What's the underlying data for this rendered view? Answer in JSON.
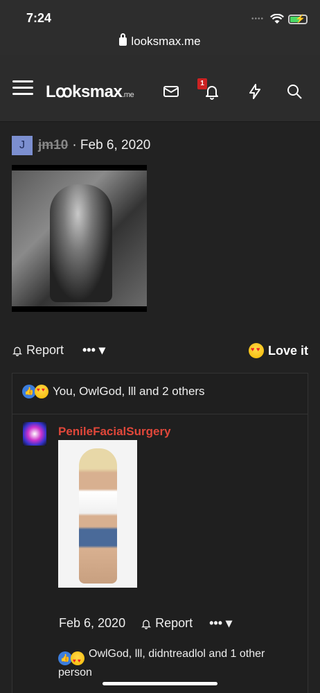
{
  "status_bar": {
    "time": "7:24"
  },
  "browser": {
    "url": "looksmax.me"
  },
  "nav": {
    "logo": "Lꝏksmax",
    "logo_tld": ".me",
    "notification_count": "1"
  },
  "post": {
    "avatar_letter": "J",
    "username": "jm10",
    "date": "· Feb 6, 2020",
    "report_label": "Report",
    "more_label": "••• ▾",
    "love_label": "Love it"
  },
  "reactions": {
    "summary": "You, OwlGod, lll and 2 others"
  },
  "reply": {
    "username": "PenileFacialSurgery",
    "date": "Feb 6, 2020",
    "report_label": "Report",
    "more_label": "••• ▾",
    "reactions_text": "OwlGod, lll, didntreadlol and 1 other person"
  },
  "colors": {
    "background": "#222222",
    "header": "#2c2c2c",
    "username_red": "#e0473a",
    "avatar_blue": "#7c8fd0",
    "like_blue": "#3b7ddd",
    "badge_red": "#cc2222"
  },
  "icons": [
    "lock-icon",
    "hamburger-menu-icon",
    "mail-icon",
    "bell-icon",
    "bolt-icon",
    "search-icon",
    "report-bell-icon",
    "love-emoji-icon",
    "like-icon"
  ]
}
